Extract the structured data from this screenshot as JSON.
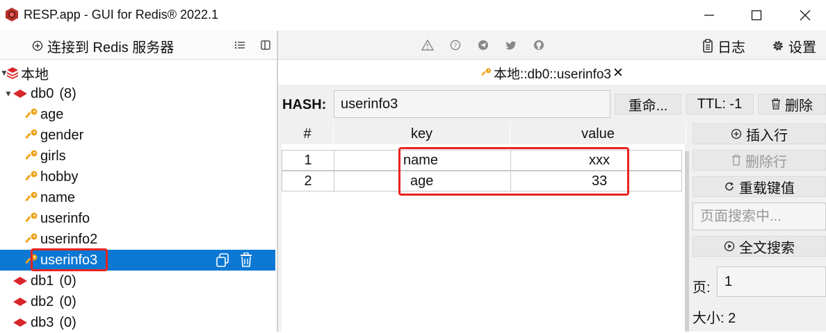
{
  "window": {
    "title": "RESP.app - GUI for Redis® 2022.1",
    "minimize": "—",
    "maximize": "☐",
    "close": "✕"
  },
  "left_toolbar": {
    "connect_label": "连接到 Redis 服务器"
  },
  "tree": {
    "root_label": "本地",
    "db0_label": "db0",
    "db0_count": "(8)",
    "keys": [
      "age",
      "gender",
      "girls",
      "hobby",
      "name",
      "userinfo",
      "userinfo2",
      "userinfo3"
    ],
    "selected_key": "userinfo3",
    "other_dbs": [
      {
        "label": "db1",
        "count": "(0)"
      },
      {
        "label": "db2",
        "count": "(0)"
      },
      {
        "label": "db3",
        "count": "(0)"
      }
    ]
  },
  "right_toolbar": {
    "log_label": "日志",
    "settings_label": "设置"
  },
  "tab": {
    "label": "本地::db0::userinfo3",
    "close": "✕"
  },
  "key_view": {
    "type_label": "HASH:",
    "key_name": "userinfo3",
    "rename_label": "重命...",
    "ttl_label": "TTL:  -1",
    "delete_label": "删除",
    "columns": [
      "#",
      "key",
      "value"
    ],
    "rows": [
      {
        "index": "1",
        "key": "name",
        "value": "xxx"
      },
      {
        "index": "2",
        "key": "age",
        "value": "33"
      }
    ],
    "insert_row_label": "插入行",
    "delete_row_label": "删除行",
    "reload_label": "重载键值",
    "search_placeholder": "页面搜索中...",
    "fulltext_label": "全文搜索",
    "page_label": "页:",
    "page_value": "1",
    "size_label": "大小:",
    "size_value": "2"
  },
  "colors": {
    "selection": "#0c78d4",
    "highlight_box": "#e8231f",
    "key_icon": "#f0a21a",
    "db_icon": "#d9262b"
  }
}
